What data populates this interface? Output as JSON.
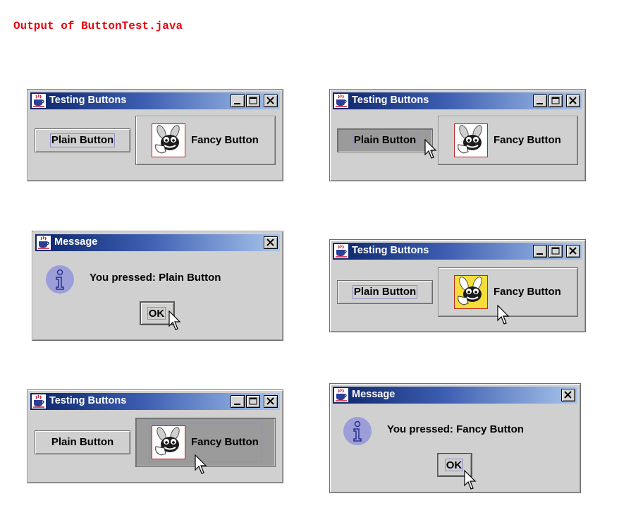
{
  "caption": "Output of ButtonTest.java",
  "colors": {
    "caption": "#e8000b",
    "title_gradient_start": "#0b2467",
    "title_gradient_end": "#a8c5ec",
    "window_bg": "#d0d0d0",
    "pressed_bg": "#9b9b9b",
    "focus_ring": "#8b90c9",
    "info_icon": "#9b9ed8"
  },
  "icons": {
    "app": "java-coffee-cup-icon",
    "minimize": "minimize-icon",
    "maximize": "maximize-icon",
    "close": "close-icon",
    "fancy": "bug-mascot-icon",
    "message": "info-icon",
    "pointer": "mouse-cursor-icon"
  },
  "windows": {
    "w1": {
      "title": "Testing Buttons",
      "plain_label": "Plain Button",
      "fancy_label": "Fancy Button"
    },
    "w2": {
      "title": "Testing Buttons",
      "plain_label": "Plain Button",
      "fancy_label": "Fancy Button"
    },
    "w3": {
      "title": "Message",
      "message": "You pressed: Plain Button",
      "ok_label": "OK"
    },
    "w4": {
      "title": "Testing Buttons",
      "plain_label": "Plain Button",
      "fancy_label": "Fancy Button"
    },
    "w5": {
      "title": "Testing Buttons",
      "plain_label": "Plain Button",
      "fancy_label": "Fancy Button"
    },
    "w6": {
      "title": "Message",
      "message": "You pressed: Fancy Button",
      "ok_label": "OK"
    }
  }
}
